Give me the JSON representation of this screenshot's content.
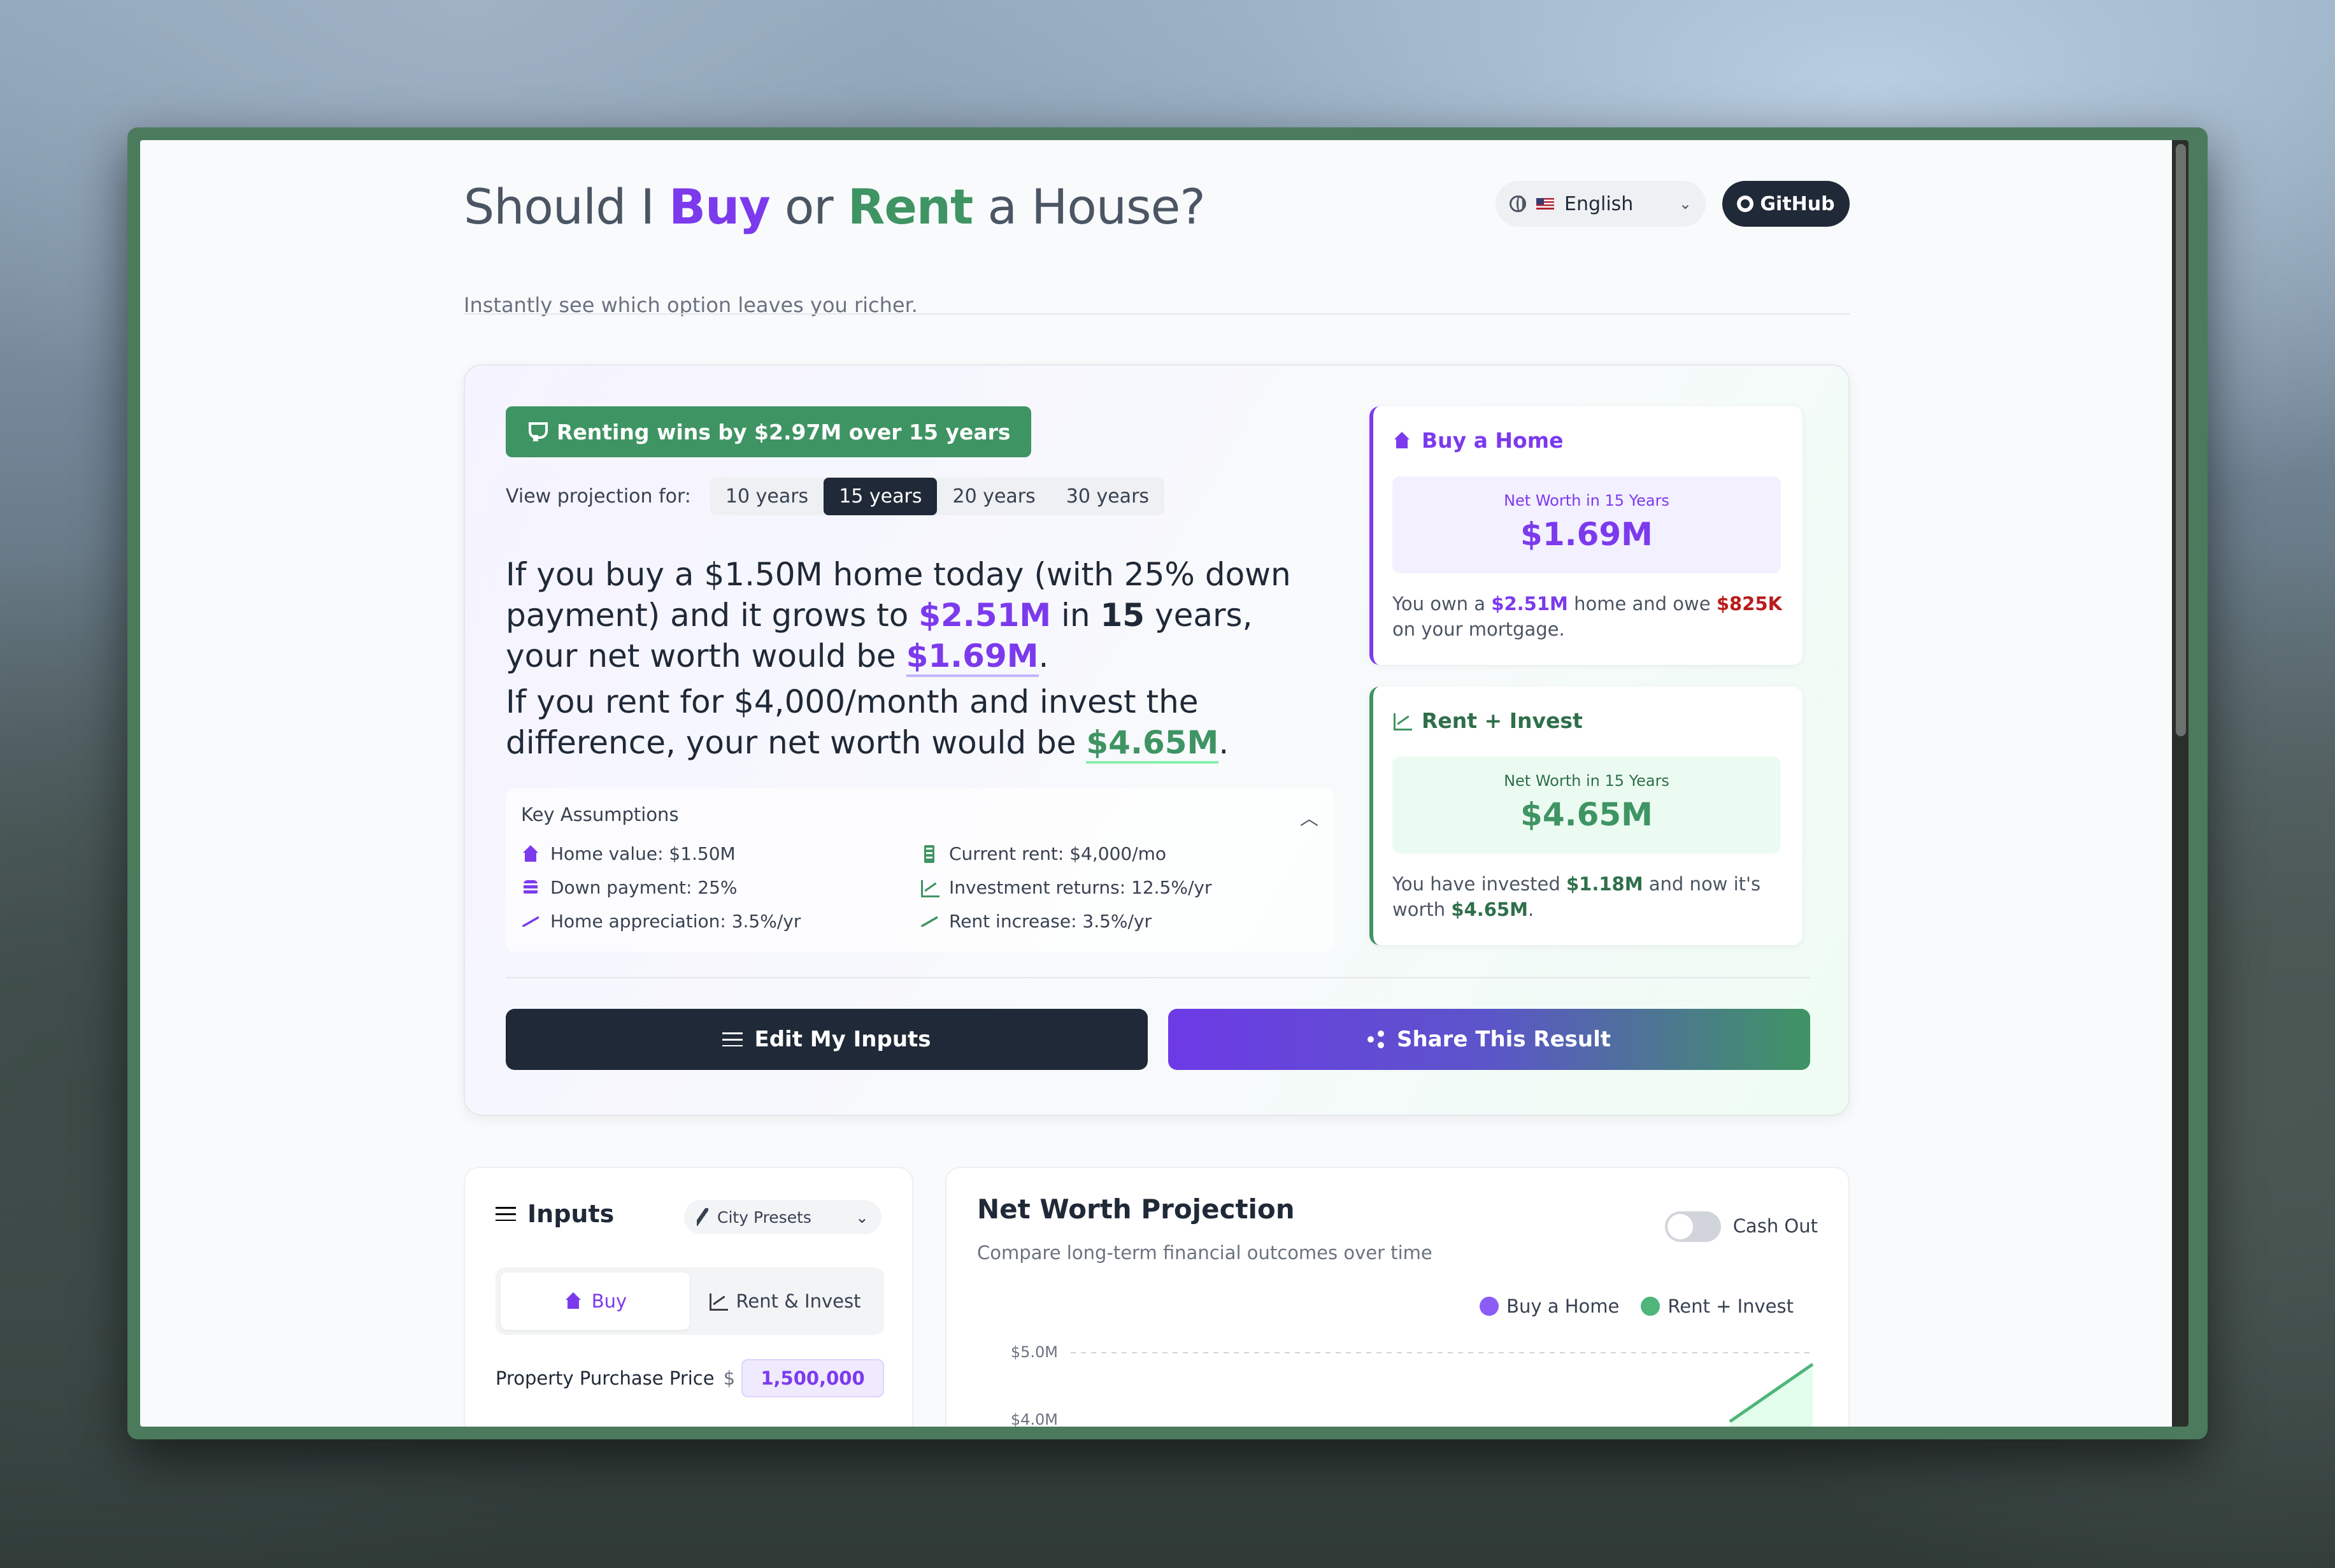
{
  "header": {
    "title_pre": "Should I ",
    "title_buy": "Buy",
    "title_mid": " or ",
    "title_rent": "Rent",
    "title_post": " a House?",
    "subtitle": "Instantly see which option leaves you richer.",
    "language": "English",
    "github": "GitHub"
  },
  "result": {
    "badge": "Renting wins by $2.97M over 15 years",
    "projection_label": "View projection for:",
    "year_tabs": [
      "10 years",
      "15 years",
      "20 years",
      "30 years"
    ],
    "active_year_tab": "15 years",
    "story": {
      "p1_a": "If you buy a $1.50M home today (with 25% down payment) and it grows to ",
      "p1_value": "$2.51M",
      "p1_b": " in ",
      "p1_years": "15",
      "p1_c": " years, your net worth would be ",
      "p1_networth": "$1.69M",
      "p1_end": ".",
      "p2_a": "If you rent for $4,000/month and invest the difference, your net worth would be ",
      "p2_networth": "$4.65M",
      "p2_end": "."
    },
    "assumptions": {
      "title": "Key Assumptions",
      "items": [
        {
          "icon": "house-icon",
          "text": "Home value: $1.50M"
        },
        {
          "icon": "building-icon",
          "text": "Current rent: $4,000/mo"
        },
        {
          "icon": "coins-icon",
          "text": "Down payment: 25%"
        },
        {
          "icon": "chart-line-icon",
          "text": "Investment returns: 12.5%/yr"
        },
        {
          "icon": "trending-up-icon",
          "text": "Home appreciation: 3.5%/yr"
        },
        {
          "icon": "trending-up-icon",
          "text": "Rent increase: 3.5%/yr"
        }
      ]
    },
    "edit_button": "Edit My Inputs",
    "share_button": "Share This Result",
    "buy_card": {
      "title": "Buy a Home",
      "label": "Net Worth in 15 Years",
      "value": "$1.69M",
      "desc_a": "You own a ",
      "desc_home": "$2.51M",
      "desc_b": " home and owe ",
      "desc_owe": "$825K",
      "desc_c": " on your mortgage."
    },
    "rent_card": {
      "title": "Rent + Invest",
      "label": "Net Worth in 15 Years",
      "value": "$4.65M",
      "desc_a": "You have invested ",
      "desc_inv": "$1.18M",
      "desc_b": " and now it's worth ",
      "desc_worth": "$4.65M",
      "desc_c": "."
    }
  },
  "inputs_panel": {
    "title": "Inputs",
    "presets": "City Presets",
    "tab_buy": "Buy",
    "tab_rent": "Rent & Invest",
    "price_label": "Property Purchase Price",
    "currency": "$",
    "price_value": "1,500,000"
  },
  "projection_panel": {
    "title": "Net Worth Projection",
    "subtitle": "Compare long-term financial outcomes over time",
    "toggle_label": "Cash Out",
    "legend_buy": "Buy a Home",
    "legend_rent": "Rent + Invest",
    "y_ticks": [
      "$5.0M",
      "$4.0M"
    ]
  },
  "colors": {
    "buy": "#7c3aed",
    "rent": "#3f9463",
    "dark": "#1f2937"
  }
}
